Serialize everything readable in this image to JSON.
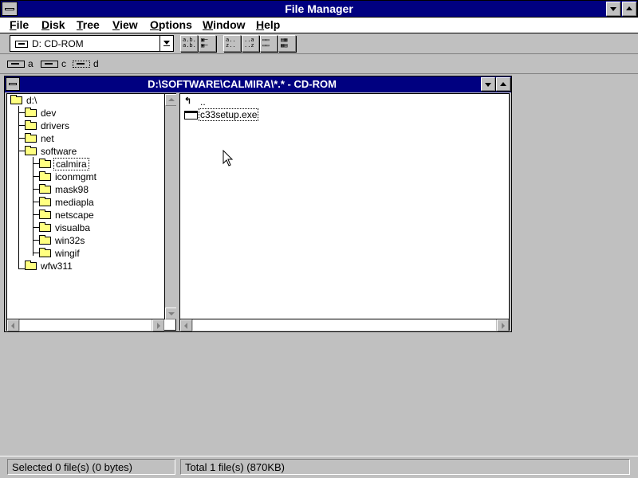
{
  "window": {
    "title": "File Manager"
  },
  "menu": [
    "File",
    "Disk",
    "Tree",
    "View",
    "Options",
    "Window",
    "Help"
  ],
  "toolbar": {
    "drive_selector": "D: CD-ROM",
    "buttons": [
      "connect-net-drive",
      "disconnect-net-drive",
      "view-list",
      "view-details",
      "sort-name",
      "sort-type",
      "sort-size",
      "sort-date"
    ]
  },
  "drives": [
    {
      "letter": "a",
      "selected": false
    },
    {
      "letter": "c",
      "selected": false
    },
    {
      "letter": "d",
      "selected": true
    }
  ],
  "child_window": {
    "title": "D:\\SOFTWARE\\CALMIRA\\*.* - CD-ROM"
  },
  "tree": [
    {
      "label": "d:\\",
      "level": 0
    },
    {
      "label": "dev",
      "level": 1
    },
    {
      "label": "drivers",
      "level": 1
    },
    {
      "label": "net",
      "level": 1
    },
    {
      "label": "software",
      "level": 1
    },
    {
      "label": "calmira",
      "level": 2,
      "selected": true,
      "open": true
    },
    {
      "label": "iconmgmt",
      "level": 2
    },
    {
      "label": "mask98",
      "level": 2
    },
    {
      "label": "mediapla",
      "level": 2
    },
    {
      "label": "netscape",
      "level": 2
    },
    {
      "label": "visualba",
      "level": 2
    },
    {
      "label": "win32s",
      "level": 2
    },
    {
      "label": "wingif",
      "level": 2
    },
    {
      "label": "wfw311",
      "level": 1
    }
  ],
  "files": [
    {
      "label": "..",
      "type": "parent"
    },
    {
      "label": "c33setup.exe",
      "type": "exe",
      "focused": true
    }
  ],
  "status": {
    "selected": "Selected 0 file(s) (0 bytes)",
    "total": "Total 1 file(s) (870KB)"
  }
}
